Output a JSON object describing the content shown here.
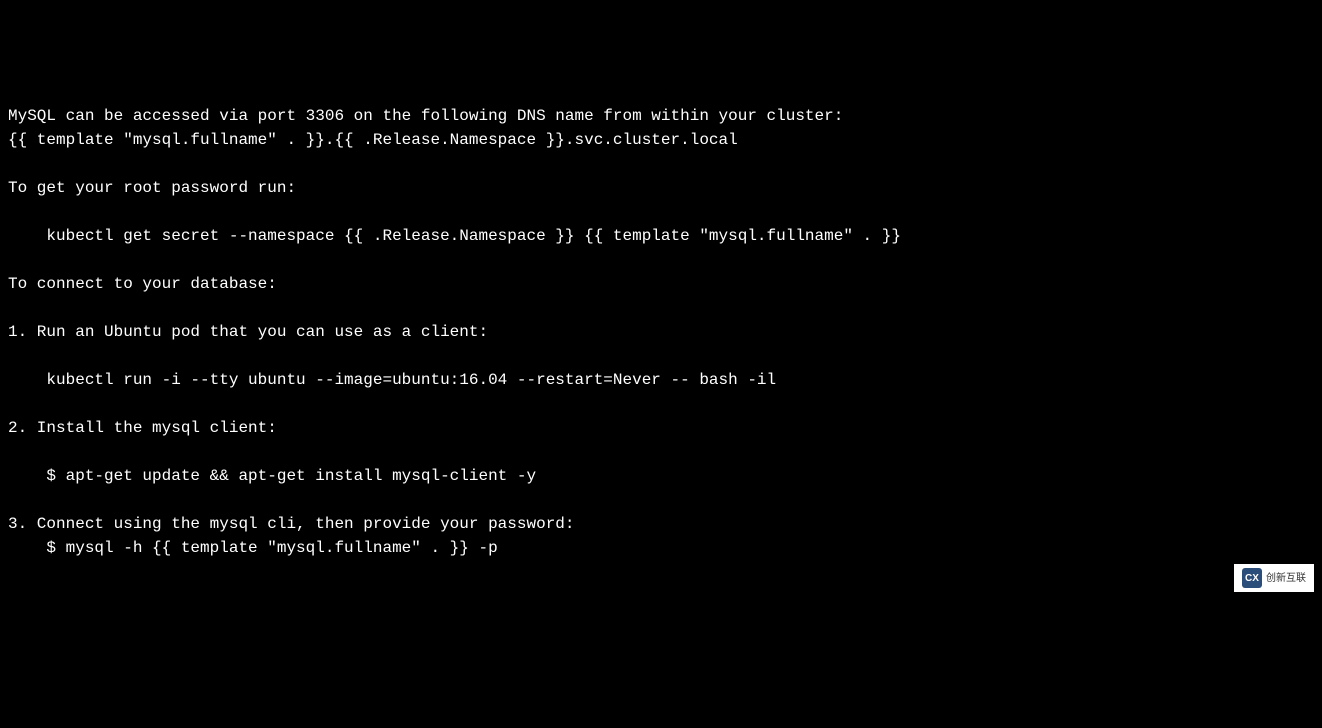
{
  "terminal": {
    "lines": [
      "MySQL can be accessed via port 3306 on the following DNS name from within your cluster:",
      "{{ template \"mysql.fullname\" . }}.{{ .Release.Namespace }}.svc.cluster.local",
      "",
      "To get your root password run:",
      "",
      "    kubectl get secret --namespace {{ .Release.Namespace }} {{ template \"mysql.fullname\" . }}",
      "",
      "To connect to your database:",
      "",
      "1. Run an Ubuntu pod that you can use as a client:",
      "",
      "    kubectl run -i --tty ubuntu --image=ubuntu:16.04 --restart=Never -- bash -il",
      "",
      "2. Install the mysql client:",
      "",
      "    $ apt-get update && apt-get install mysql-client -y",
      "",
      "3. Connect using the mysql cli, then provide your password:",
      "    $ mysql -h {{ template \"mysql.fullname\" . }} -p"
    ]
  },
  "watermark": {
    "logo_text": "CX",
    "text": "创新互联"
  }
}
